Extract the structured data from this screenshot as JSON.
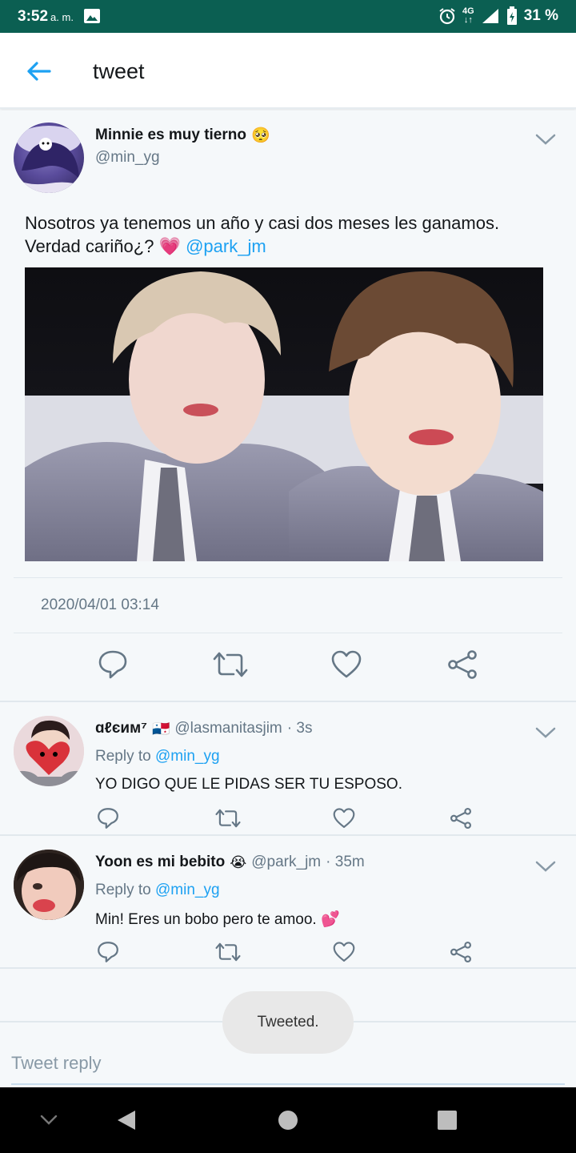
{
  "status_bar": {
    "time": "3:52",
    "ampm": "a. m.",
    "network": "4G",
    "battery": "31 %"
  },
  "app_bar": {
    "title": "tweet",
    "back_icon": "arrow-left-icon"
  },
  "main_tweet": {
    "display_name": "Minnie es muy tierno",
    "name_emoji": "🥺",
    "handle": "@min_yg",
    "text": "Nosotros ya tenemos un año y casi dos meses les ganamos. Verdad cariño¿? ",
    "text_emoji": "💗",
    "mention": "@park_jm",
    "timestamp": "2020/04/01 03:14"
  },
  "replies": [
    {
      "display_name": "ɑℓєим⁷",
      "name_emoji": "🇵🇦",
      "handle": "@lasmanitasjim",
      "time": "· 3s",
      "reply_prefix": "Reply to",
      "reply_to": "@min_yg",
      "text": "YO DIGO QUE LE PIDAS SER TU ESPOSO."
    },
    {
      "display_name": "Yoon es mi bebito",
      "name_emoji": "😭",
      "handle": "@park_jm",
      "time": "· 35m",
      "reply_prefix": "Reply to",
      "reply_to": "@min_yg",
      "text": "Min! Eres un bobo pero te amoo. ",
      "text_emoji": "💕"
    }
  ],
  "toast": "Tweeted.",
  "composer": {
    "placeholder": "Tweet reply"
  },
  "colors": {
    "status_bar": "#0b5f52",
    "accent": "#1da1f2",
    "secondary_text": "#657786",
    "background": "#f5f8fa"
  }
}
